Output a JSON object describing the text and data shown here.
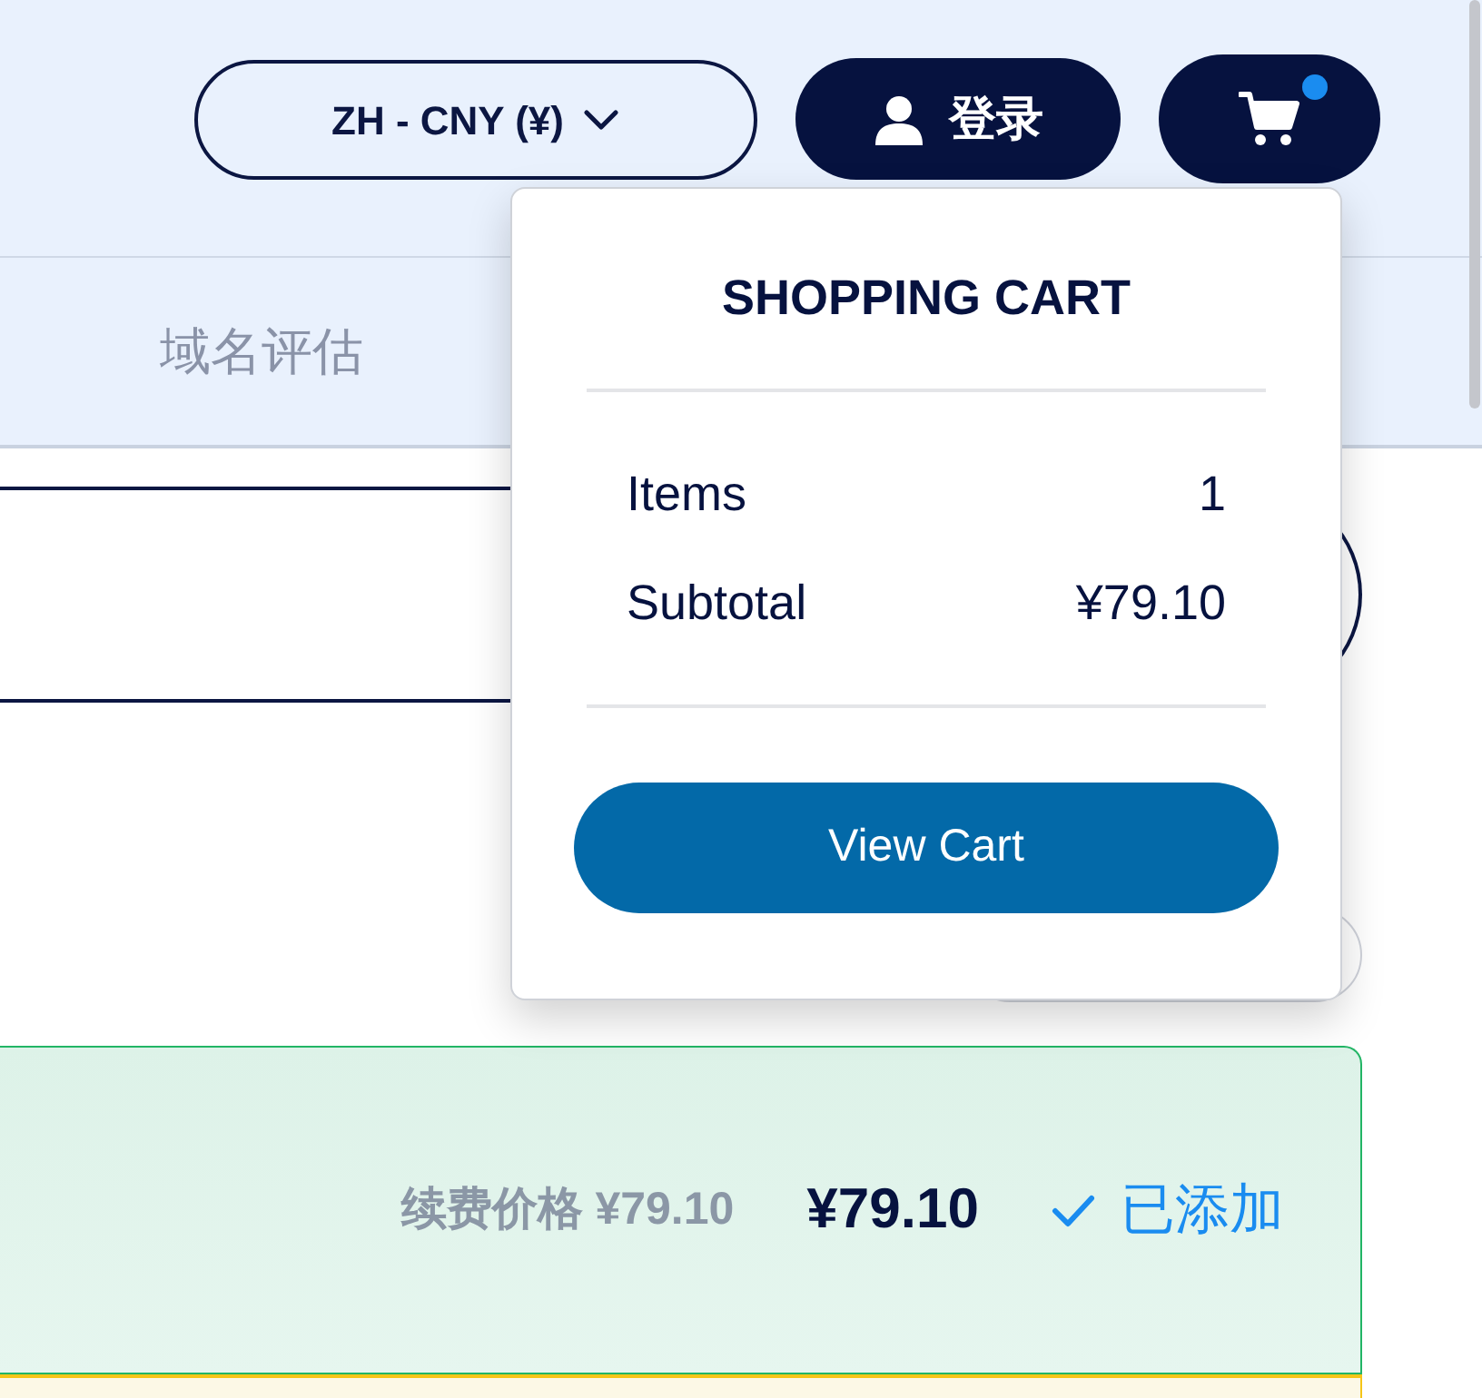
{
  "header": {
    "currency_selector": {
      "label": "ZH - CNY (¥)"
    },
    "login_button": {
      "label": "登录"
    },
    "cart_button": {
      "has_items": true
    }
  },
  "nav": {
    "items": [
      {
        "label": "域名评估",
        "selected": false
      }
    ]
  },
  "cart_popup": {
    "title": "SHOPPING CART",
    "rows": [
      {
        "label": "Items",
        "value": "1"
      },
      {
        "label": "Subtotal",
        "value": "¥79.10"
      }
    ],
    "button": "View Cart"
  },
  "result": {
    "renewal_price": "续费价格 ¥79.10",
    "price": "¥79.10",
    "status": "已添加",
    "added": true
  }
}
